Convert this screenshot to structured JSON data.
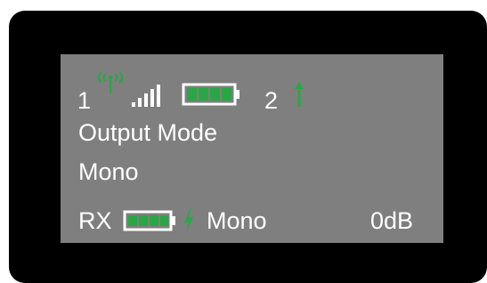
{
  "colors": {
    "bezel": "#000000",
    "screen": "#7f7f7f",
    "text": "#ffffff",
    "accent_green": "#27a844"
  },
  "status_bar": {
    "channel_1": "1",
    "antenna_icon": "antenna-signal-icon",
    "signal_icon": "signal-bars-icon",
    "signal_level": 5,
    "battery_icon": "battery-icon",
    "battery_level": 1.0,
    "channel_2": "2",
    "arrow_icon": "arrow-up-icon"
  },
  "menu": {
    "title": "Output Mode",
    "value": "Mono"
  },
  "receiver_bar": {
    "label": "RX",
    "battery_icon": "battery-icon",
    "battery_level": 1.0,
    "charging_icon": "lightning-bolt-icon",
    "mode": "Mono",
    "gain": "0dB"
  }
}
